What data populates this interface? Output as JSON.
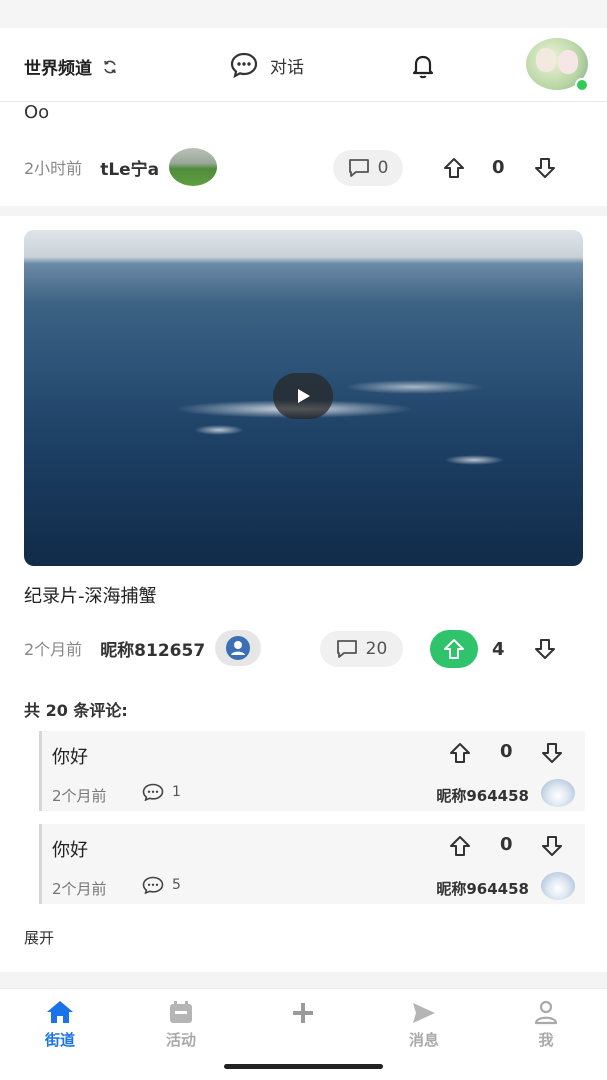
{
  "header": {
    "channel": "世界频道",
    "dialog": "对话"
  },
  "post1": {
    "text": "Oo",
    "time": "2小时前",
    "author": "tLe宁a",
    "comments": "0",
    "votes": "0"
  },
  "post2": {
    "title": "纪录片-深海捕蟹",
    "time": "2个月前",
    "author": "昵称812657",
    "comments": "20",
    "votes": "4",
    "comments_total": "共 20 条评论:",
    "expand": "展开"
  },
  "comments": [
    {
      "text": "你好",
      "time": "2个月前",
      "replies": "1",
      "author": "昵称964458",
      "votes": "0"
    },
    {
      "text": "你好",
      "time": "2个月前",
      "replies": "5",
      "author": "昵称964458",
      "votes": "0"
    }
  ],
  "tabs": [
    {
      "label": "街道",
      "icon": "home-icon",
      "active": true
    },
    {
      "label": "活动",
      "icon": "calendar-icon",
      "active": false
    },
    {
      "label": "",
      "icon": "plus-icon",
      "active": false
    },
    {
      "label": "消息",
      "icon": "send-icon",
      "active": false
    },
    {
      "label": "我",
      "icon": "user-icon",
      "active": false
    }
  ],
  "colors": {
    "accent": "#1a73e8",
    "upvote_active": "#2fc36b",
    "online": "#2ecc55"
  }
}
